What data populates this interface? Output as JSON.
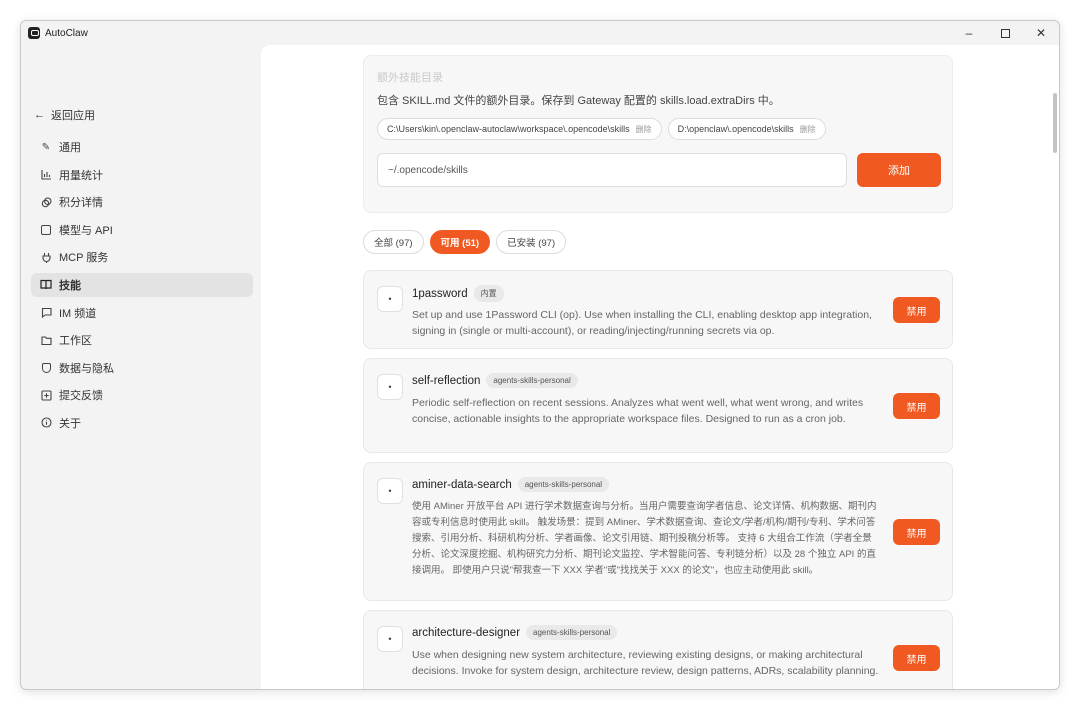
{
  "window": {
    "title": "AutoClaw",
    "controls": {
      "minimize": "–",
      "close": "✕"
    }
  },
  "sidebar": {
    "back_label": "返回应用",
    "items": [
      {
        "label": "通用",
        "icon": "pencil-icon"
      },
      {
        "label": "用量统计",
        "icon": "bar-chart-icon"
      },
      {
        "label": "积分详情",
        "icon": "coin-icon"
      },
      {
        "label": "模型与 API",
        "icon": "chip-icon"
      },
      {
        "label": "MCP 服务",
        "icon": "plug-icon"
      },
      {
        "label": "技能",
        "icon": "book-icon",
        "active": true
      },
      {
        "label": "IM 频道",
        "icon": "chat-icon"
      },
      {
        "label": "工作区",
        "icon": "folder-icon"
      },
      {
        "label": "数据与隐私",
        "icon": "shield-icon"
      },
      {
        "label": "提交反馈",
        "icon": "feedback-icon"
      },
      {
        "label": "关于",
        "icon": "info-icon"
      }
    ]
  },
  "extra_dirs": {
    "title": "额外技能目录",
    "description": "包含 SKILL.md 文件的额外目录。保存到 Gateway 配置的 skills.load.extraDirs 中。",
    "dirs": [
      {
        "path": "C:\\Users\\kin\\.openclaw-autoclaw\\workspace\\.opencode\\skills",
        "remove": "删除"
      },
      {
        "path": "D:\\openclaw\\.opencode\\skills",
        "remove": "删除"
      }
    ],
    "input_value": "~/.opencode/skills",
    "add_label": "添加"
  },
  "filters": [
    {
      "label": "全部 (97)",
      "active": false
    },
    {
      "label": "可用 (51)",
      "active": true
    },
    {
      "label": "已安装 (97)",
      "active": false
    }
  ],
  "skills": [
    {
      "icon": "•",
      "name": "1password",
      "tag": "内置",
      "description": "Set up and use 1Password CLI (op). Use when installing the CLI, enabling desktop app integration, signing in (single or multi-account), or reading/injecting/running secrets via op.",
      "action": "禁用"
    },
    {
      "icon": "•",
      "name": "self-reflection",
      "tag": "agents-skills-personal",
      "description": "Periodic self-reflection on recent sessions. Analyzes what went well, what went wrong, and writes concise, actionable insights to the appropriate workspace files. Designed to run as a cron job.",
      "action": "禁用"
    },
    {
      "icon": "•",
      "name": "aminer-data-search",
      "tag": "agents-skills-personal",
      "description": "使用 AMiner 开放平台 API 进行学术数据查询与分析。当用户需要查询学者信息、论文详情、机构数据、期刊内容或专利信息时使用此 skill。 触发场景：提到 AMiner、学术数据查询、查论文/学者/机构/期刊/专利、学术问答搜索、引用分析、科研机构分析、学者画像、论文引用链、期刊投稿分析等。 支持 6 大组合工作流（学者全景分析、论文深度挖掘、机构研究力分析、期刊论文监控、学术智能问答、专利链分析）以及 28 个独立 API 的直接调用。 即使用户只说\"帮我查一下 XXX 学者\"或\"找找关于 XXX 的论文\"，也应主动使用此 skill。",
      "action": "禁用"
    },
    {
      "icon": "•",
      "name": "architecture-designer",
      "tag": "agents-skills-personal",
      "description": "Use when designing new system architecture, reviewing existing designs, or making architectural decisions. Invoke for system design, architecture review, design patterns, ADRs, scalability planning.",
      "action": "禁用"
    }
  ],
  "colors": {
    "accent": "#f05a22",
    "sidebar_bg": "#f3f3f3",
    "card_bg": "#f7f7f7"
  }
}
